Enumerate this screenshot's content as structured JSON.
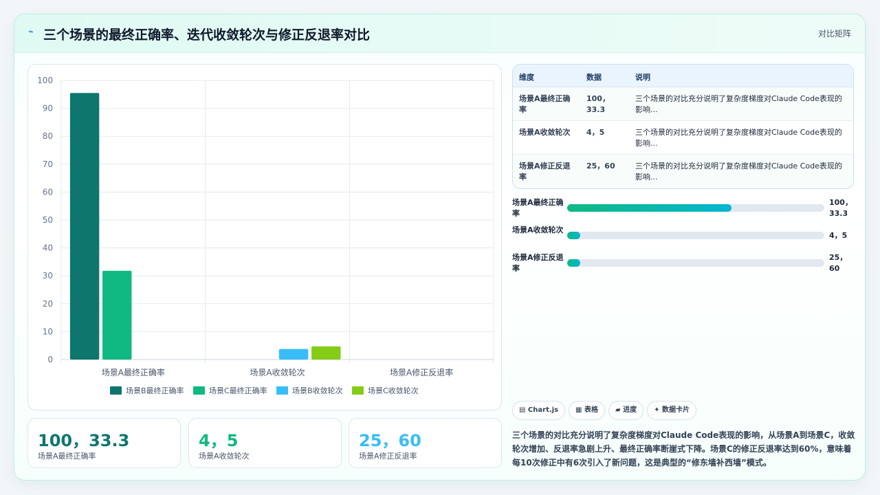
{
  "header": {
    "icon": "lightning-icon",
    "title": "三个场景的最终正确率、迭代收敛轮次与修正反退率对比",
    "tag": "对比矩阵"
  },
  "chart_data": {
    "type": "bar",
    "categories": [
      "场景A最终正确率",
      "场景A收敛轮次",
      "场景A修正反退率"
    ],
    "series": [
      {
        "name": "场景B最终正确率",
        "color": "#0f766e",
        "values": [
          95.5,
          null,
          null
        ]
      },
      {
        "name": "场景C最终正确率",
        "color": "#10b981",
        "values": [
          31.8,
          null,
          null
        ]
      },
      {
        "name": "场景B收敛轮次",
        "color": "#38bdf8",
        "values": [
          null,
          3.8,
          null
        ]
      },
      {
        "name": "场景C收敛轮次",
        "color": "#84cc16",
        "values": [
          null,
          4.7,
          null
        ]
      }
    ],
    "ylim": [
      0,
      100
    ],
    "yticks": [
      0,
      10,
      20,
      30,
      40,
      50,
      60,
      70,
      80,
      90,
      100
    ],
    "grid": true,
    "legend": "bottom"
  },
  "stats": [
    {
      "value": "100，33.3",
      "label": "场景A最终正确率",
      "color": "#0f766e"
    },
    {
      "value": "4，5",
      "label": "场景A收敛轮次",
      "color": "#10b981"
    },
    {
      "value": "25，60",
      "label": "场景A修正反退率",
      "color": "#38bdf8"
    }
  ],
  "table": {
    "headers": [
      "维度",
      "数据",
      "说明"
    ],
    "rows": [
      [
        "场景A最终正确率",
        "100，33.3",
        "三个场景的对比充分说明了复杂度梯度对Claude Code表现的影响..."
      ],
      [
        "场景A收敛轮次",
        "4，5",
        "三个场景的对比充分说明了复杂度梯度对Claude Code表现的影响..."
      ],
      [
        "场景A修正反退率",
        "25，60",
        "三个场景的对比充分说明了复杂度梯度对Claude Code表现的影响..."
      ]
    ]
  },
  "progress": [
    {
      "label": "场景A最终正确率",
      "value": "100，33.3",
      "fraction": 0.64
    },
    {
      "label": "场景A收敛轮次",
      "value": "4，5",
      "fraction": 0.05
    },
    {
      "label": "场景A修正反退率",
      "value": "25，60",
      "fraction": 0.05
    }
  ],
  "chips": [
    {
      "icon": "chart-icon",
      "label": "▤ Chart.js"
    },
    {
      "icon": "table-icon",
      "label": "▦ 表格"
    },
    {
      "icon": "progress-icon",
      "label": "▰ 进度"
    },
    {
      "icon": "sparkle-icon",
      "label": "✦ 数据卡片"
    }
  ],
  "summary": "三个场景的对比充分说明了复杂度梯度对Claude Code表现的影响，从场景A到场景C，收敛轮次增加、反退率急剧上升、最终正确率断崖式下降。场景C的修正反退率达到60%，意味着每10次修正中有6次引入了新问题，这是典型的“修东墙补西墙”模式。"
}
